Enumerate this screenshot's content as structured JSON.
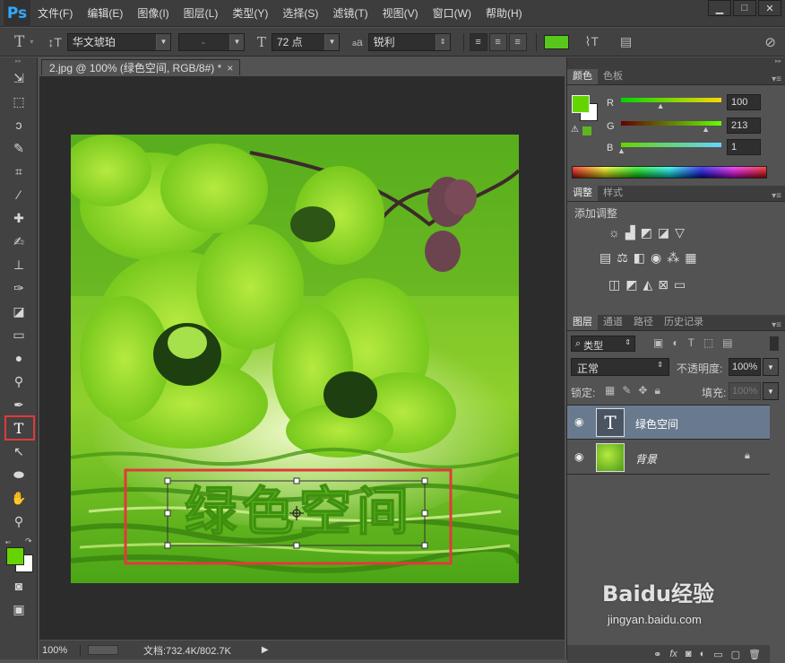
{
  "app": {
    "logo": "Ps"
  },
  "menu": [
    "文件(F)",
    "编辑(E)",
    "图像(I)",
    "图层(L)",
    "类型(Y)",
    "选择(S)",
    "滤镜(T)",
    "视图(V)",
    "窗口(W)",
    "帮助(H)"
  ],
  "window_controls": {
    "minimize": "▁",
    "restore": "□",
    "close": "✕"
  },
  "options": {
    "font_family": "华文琥珀",
    "font_style": "-",
    "font_size": "72 点",
    "antialias_label": "a",
    "antialias": "锐利",
    "text_color": "#58c71b"
  },
  "tools": [
    "move-icon",
    "marquee-icon",
    "lasso-icon",
    "quick-select-icon",
    "crop-icon",
    "eyedropper-icon",
    "healing-icon",
    "brush-icon",
    "stamp-icon",
    "history-brush-icon",
    "eraser-icon",
    "gradient-icon",
    "blur-icon",
    "dodge-icon",
    "pen-icon",
    "type-icon",
    "path-select-icon",
    "ellipse-icon",
    "hand-icon",
    "zoom-icon"
  ],
  "document": {
    "tab_title": "2.jpg @ 100% (绿色空间, RGB/8#) *",
    "tab_close": "×",
    "text_layer_content": "绿色空间"
  },
  "status": {
    "zoom": "100%",
    "doc_info": "文档:732.4K/802.7K"
  },
  "color_panel": {
    "tabs": [
      "颜色",
      "色板"
    ],
    "r_label": "R",
    "g_label": "G",
    "b_label": "B",
    "r": "100",
    "g": "213",
    "b": "1",
    "r_fraction": 0.39,
    "g_fraction": 0.84,
    "b_fraction": 0.0,
    "foreground": "#64d501"
  },
  "adjust_panel": {
    "tabs": [
      "调整",
      "样式"
    ],
    "title": "添加调整"
  },
  "layers_panel": {
    "tabs": [
      "图层",
      "通道",
      "路径",
      "历史记录"
    ],
    "filter": "类型",
    "blend_mode": "正常",
    "opacity_label": "不透明度:",
    "opacity": "100%",
    "lock_label": "锁定:",
    "fill_label": "填充:",
    "fill": "100%",
    "layers": [
      {
        "name": "绿色空间",
        "type": "text",
        "selected": true
      },
      {
        "name": "背景",
        "type": "image",
        "locked": true
      }
    ]
  },
  "watermark": {
    "brand": "Baidu经验",
    "url": "jingyan.baidu.com"
  }
}
